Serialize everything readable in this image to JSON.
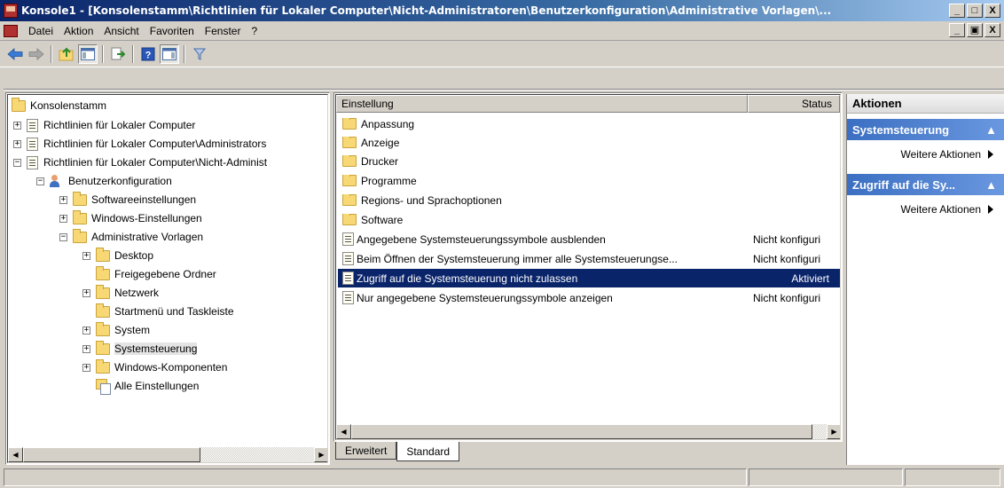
{
  "window": {
    "title": "Konsole1 - [Konsolenstamm\\Richtlinien für Lokaler Computer\\Nicht-Administratoren\\Benutzerkonfiguration\\Administrative Vorlagen\\...",
    "minimize": "_",
    "restore": "□",
    "close": "X"
  },
  "mdi": {
    "minimize": "_",
    "restore": "▣",
    "close": "X"
  },
  "menu": {
    "datei": "Datei",
    "aktion": "Aktion",
    "ansicht": "Ansicht",
    "favoriten": "Favoriten",
    "fenster": "Fenster",
    "help": "?"
  },
  "toolbar": {
    "icons": [
      "back-icon",
      "forward-icon",
      "up-folder-icon",
      "show-hide-tree-icon",
      "export-list-icon",
      "help-icon",
      "show-hide-actions-icon",
      "filter-icon"
    ]
  },
  "tree": {
    "root": "Konsolenstamm",
    "items": [
      {
        "label": "Richtlinien für Lokaler Computer"
      },
      {
        "label": "Richtlinien für Lokaler Computer\\Administrators"
      },
      {
        "label": "Richtlinien für Lokaler Computer\\Nicht-Administ"
      },
      {
        "label": "Benutzerkonfiguration"
      },
      {
        "label": "Softwareeinstellungen"
      },
      {
        "label": "Windows-Einstellungen"
      },
      {
        "label": "Administrative Vorlagen"
      },
      {
        "label": "Desktop"
      },
      {
        "label": "Freigegebene Ordner"
      },
      {
        "label": "Netzwerk"
      },
      {
        "label": "Startmenü und Taskleiste"
      },
      {
        "label": "System"
      },
      {
        "label": "Systemsteuerung"
      },
      {
        "label": "Windows-Komponenten"
      },
      {
        "label": "Alle Einstellungen"
      }
    ]
  },
  "list": {
    "col_setting": "Einstellung",
    "col_status": "Status",
    "rows": [
      {
        "name": "Anpassung",
        "status": ""
      },
      {
        "name": "Anzeige",
        "status": ""
      },
      {
        "name": "Drucker",
        "status": ""
      },
      {
        "name": "Programme",
        "status": ""
      },
      {
        "name": "Regions- und Sprachoptionen",
        "status": ""
      },
      {
        "name": "Software",
        "status": ""
      },
      {
        "name": "Angegebene Systemsteuerungssymbole ausblenden",
        "status": "Nicht konfiguri"
      },
      {
        "name": "Beim Öffnen der Systemsteuerung immer alle Systemsteuerungse...",
        "status": "Nicht konfiguri"
      },
      {
        "name": "Zugriff auf die Systemsteuerung nicht zulassen",
        "status": "Aktiviert"
      },
      {
        "name": "Nur angegebene Systemsteuerungssymbole anzeigen",
        "status": "Nicht konfiguri"
      }
    ]
  },
  "tabs": {
    "erweitert": "Erweitert",
    "standard": "Standard"
  },
  "actions": {
    "header": "Aktionen",
    "section1": "Systemsteuerung",
    "section1_more": "Weitere Aktionen",
    "section2": "Zugriff auf die Sy...",
    "section2_more": "Weitere Aktionen"
  },
  "colors": {
    "selection": "#0a246a",
    "action_section": "#3b6fc2",
    "folder": "#f8d775"
  }
}
